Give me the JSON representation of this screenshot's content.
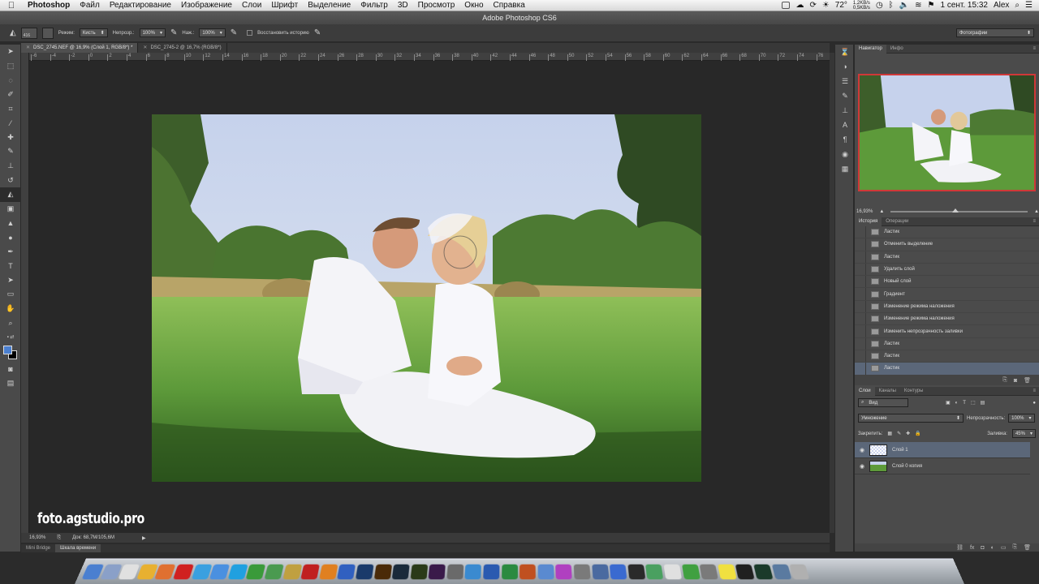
{
  "menubar": {
    "apple": "",
    "items": [
      "Photoshop",
      "Файл",
      "Редактирование",
      "Изображение",
      "Слои",
      "Шрифт",
      "Выделение",
      "Фильтр",
      "3D",
      "Просмотр",
      "Окно",
      "Справка"
    ],
    "temperature": "72°",
    "net_up": "1,2KB/s",
    "net_down": "0,5KB/s",
    "datetime": "1 сент. 15:32",
    "user": "Alex"
  },
  "window_title": "Adobe Photoshop CS6",
  "options": {
    "brush_size": "416",
    "mode_label": "Режим:",
    "mode_value": "Кисть",
    "opacity_label": "Непрозр.:",
    "opacity_value": "100%",
    "pressure_label": "Наж.:",
    "pressure_value": "100%",
    "restore_history": "Восстановить историю",
    "workspace": "Фотографии"
  },
  "tabs": [
    {
      "label": "DSC_2745.NEF @ 16,9% (Слой 1, RGB/8*) *",
      "active": true
    },
    {
      "label": "DSC_2745-2 @ 16,7% (RGB/8*)",
      "active": false
    }
  ],
  "ruler_ticks": [
    "-6",
    "-4",
    "-2",
    "0",
    "2",
    "4",
    "6",
    "8",
    "10",
    "12",
    "14",
    "16",
    "18",
    "20",
    "22",
    "24",
    "26",
    "28",
    "30",
    "32",
    "34",
    "36",
    "38",
    "40",
    "42",
    "44",
    "46",
    "48",
    "50",
    "52",
    "54",
    "56",
    "58",
    "60",
    "62",
    "64",
    "66",
    "68",
    "70",
    "72",
    "74",
    "76"
  ],
  "status": {
    "zoom": "16,93%",
    "doc": "Док: 68,7M/105,6M"
  },
  "bottom_tabs": [
    "Mini Bridge",
    "Шкала времени"
  ],
  "watermark": "foto.agstudio.pro",
  "navigator": {
    "tabs": [
      "Навигатор",
      "Инфо"
    ],
    "zoom": "16,93%"
  },
  "history": {
    "tabs": [
      "История",
      "Операции"
    ],
    "items": [
      "Ластик",
      "Отменить выделение",
      "Ластик",
      "Удалить слой",
      "Новый слой",
      "Градиент",
      "Изменение режима наложения",
      "Изменение режима наложения",
      "Изменить непрозрачность заливки",
      "Ластик",
      "Ластик",
      "Ластик"
    ],
    "selected_index": 11
  },
  "layers": {
    "tabs": [
      "Слои",
      "Каналы",
      "Контуры"
    ],
    "filter": "Вид",
    "blend_mode": "Умножение",
    "opacity_label": "Непрозрачность:",
    "opacity_value": "100%",
    "lock_label": "Закрепить:",
    "fill_label": "Заливка:",
    "fill_value": "45%",
    "items": [
      {
        "name": "Слой 1",
        "selected": true
      },
      {
        "name": "Слой 0 копия",
        "selected": false
      }
    ]
  },
  "dock_icons": [
    "finder-icon",
    "preview-icon",
    "calendar-icon",
    "chrome-icon",
    "firefox-icon",
    "opera-icon",
    "safari-icon",
    "appstore-icon",
    "skype-icon",
    "utorrent-icon",
    "facetime-icon",
    "cyberduck-icon",
    "filezilla-icon",
    "vlc-icon",
    "quicktime-icon",
    "photoshop-icon",
    "illustrator-icon",
    "lightroom-icon",
    "dreamweaver-icon",
    "premiere-icon",
    "aperture-icon",
    "iphoto-icon",
    "word-icon",
    "excel-icon",
    "powerpoint-icon",
    "mail-icon",
    "itunes-icon",
    "system-prefs-icon",
    "network-icon",
    "keynote-icon",
    "dashboard-icon",
    "activity-icon",
    "textedit-icon",
    "numbers-icon",
    "calculator-icon",
    "stickies-icon",
    "terminal-icon",
    "monitor-icon",
    "downloads-icon",
    "trash-icon"
  ],
  "colors": {
    "accent_selection": "#5b6779",
    "navigator_frame": "#d03838",
    "foreground": "#4a7fd0",
    "background": "#000000"
  }
}
